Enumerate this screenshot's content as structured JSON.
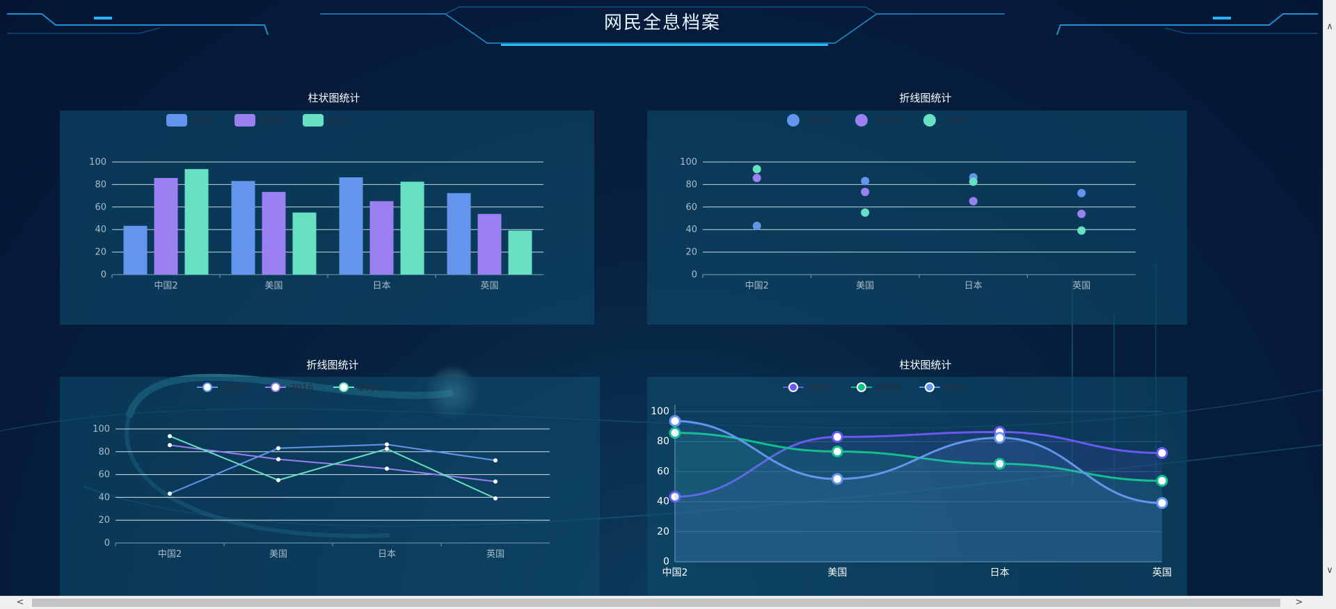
{
  "page_title": "网民全息档案",
  "panels": [
    {
      "title": "柱状图统计"
    },
    {
      "title": "折线图统计"
    },
    {
      "title": "折线图统计"
    },
    {
      "title": "柱状图统计"
    }
  ],
  "colors": {
    "c2015": "#6495ed",
    "c2016": "#9b80f2",
    "c2017": "#67e0c3",
    "smooth_a": "#6a58f0",
    "smooth_b": "#12c08c",
    "smooth_c": "#6495ed"
  },
  "chart_data": [
    {
      "type": "bar",
      "title": "柱状图统计",
      "categories": [
        "中国2",
        "美国",
        "日本",
        "英国"
      ],
      "series": [
        {
          "name": "2015",
          "values": [
            43.3,
            83.1,
            86.4,
            72.4
          ]
        },
        {
          "name": "2016",
          "values": [
            85.8,
            73.4,
            65.2,
            53.9
          ]
        },
        {
          "name": "2017",
          "values": [
            93.7,
            55.1,
            82.5,
            39.1
          ]
        }
      ],
      "ylim": [
        0,
        100
      ],
      "yticks": [
        0,
        20,
        40,
        60,
        80,
        100
      ],
      "legend": "top-center",
      "grid": true
    },
    {
      "type": "scatter",
      "title": "折线图统计",
      "categories": [
        "中国2",
        "美国",
        "日本",
        "英国"
      ],
      "series": [
        {
          "name": "2015",
          "values": [
            43.3,
            83.1,
            86.4,
            72.4
          ]
        },
        {
          "name": "2016",
          "values": [
            85.8,
            73.4,
            65.2,
            53.9
          ]
        },
        {
          "name": "2017",
          "values": [
            93.7,
            55.1,
            82.5,
            39.1
          ]
        }
      ],
      "ylim": [
        0,
        100
      ],
      "yticks": [
        0,
        20,
        40,
        60,
        80,
        100
      ],
      "legend": "top-center",
      "grid": true
    },
    {
      "type": "line",
      "title": "折线图统计",
      "categories": [
        "中国2",
        "美国",
        "日本",
        "英国"
      ],
      "series": [
        {
          "name": "2015",
          "values": [
            43.3,
            83.1,
            86.4,
            72.4
          ]
        },
        {
          "name": "2016",
          "values": [
            85.8,
            73.4,
            65.2,
            53.9
          ]
        },
        {
          "name": "2017",
          "values": [
            93.7,
            55.1,
            82.5,
            39.1
          ]
        }
      ],
      "ylim": [
        0,
        100
      ],
      "yticks": [
        0,
        20,
        40,
        60,
        80,
        100
      ],
      "legend": "top-center",
      "grid": true
    },
    {
      "type": "line",
      "title": "柱状图统计",
      "smooth": true,
      "categories": [
        "中国2",
        "美国",
        "日本",
        "英国"
      ],
      "series": [
        {
          "name": "2015",
          "values": [
            43.3,
            83.1,
            86.4,
            72.4
          ]
        },
        {
          "name": "2016",
          "values": [
            85.8,
            73.4,
            65.2,
            53.9
          ]
        },
        {
          "name": "2017",
          "values": [
            93.7,
            55.1,
            82.5,
            39.1
          ]
        }
      ],
      "ylim": [
        0,
        100
      ],
      "yticks": [
        0,
        20,
        40,
        60,
        80,
        100
      ],
      "legend": "top-center",
      "grid": true
    }
  ]
}
